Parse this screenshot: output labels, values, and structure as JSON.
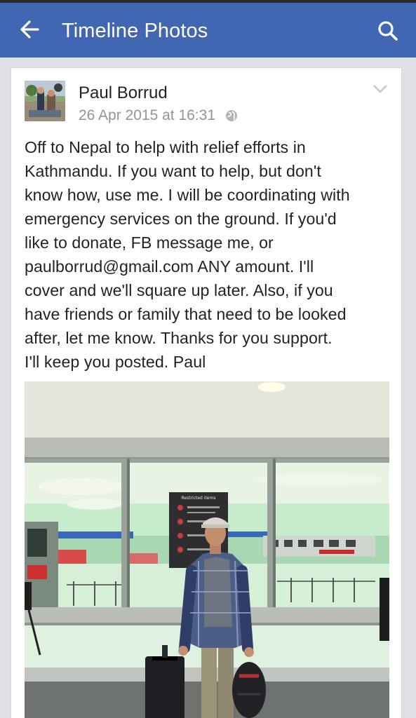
{
  "header": {
    "title": "Timeline Photos",
    "back_icon": "arrow-left-icon",
    "search_icon": "search-icon",
    "bg_color": "#4267b2"
  },
  "post": {
    "author": "Paul Borrud",
    "timestamp": "26 Apr 2015 at 16:31",
    "privacy_icon": "globe-icon",
    "menu_icon": "chevron-down-icon",
    "lines": [
      "Off to Nepal to help with relief efforts in",
      "Kathmandu.  If you want to help, but don't",
      "know how, use me.  I will be coordinating with",
      "emergency services on the ground.  If you'd",
      "like to donate, FB message me, or",
      "paulborrud@gmail.com ANY amount.  I'll",
      "cover and we'll square up later.  Also, if you",
      "have friends or family that need to be looked",
      "after, let me know.  Thanks for you support.",
      "I'll keep you posted.  Paul"
    ]
  },
  "photo": {
    "sign_title": "Restricted items"
  }
}
